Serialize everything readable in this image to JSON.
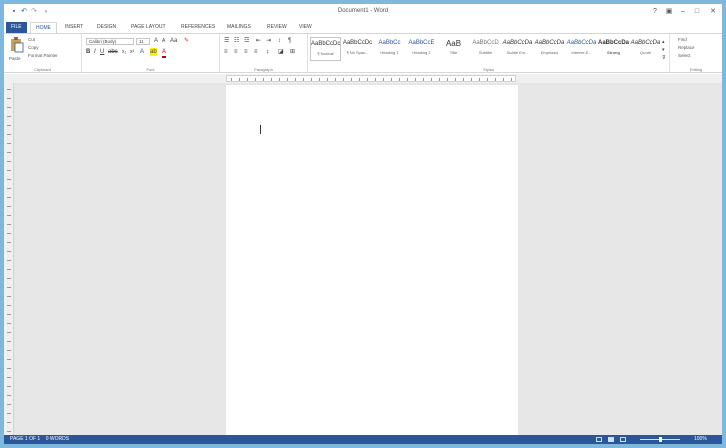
{
  "window": {
    "title": "Document1 - Word",
    "controls": {
      "help": "?",
      "ribbon_options": "▣",
      "minimize": "–",
      "maximize": "□",
      "close": "✕"
    }
  },
  "qat": {
    "save_icon": "save-icon",
    "undo_icon": "undo-icon",
    "redo_icon": "redo-icon"
  },
  "tabs": [
    {
      "label": "FILE"
    },
    {
      "label": "HOME"
    },
    {
      "label": "INSERT"
    },
    {
      "label": "DESIGN"
    },
    {
      "label": "PAGE LAYOUT"
    },
    {
      "label": "REFERENCES"
    },
    {
      "label": "MAILINGS"
    },
    {
      "label": "REVIEW"
    },
    {
      "label": "VIEW"
    }
  ],
  "ribbon": {
    "clipboard": {
      "label": "Clipboard",
      "paste": "Paste",
      "cut": "Cut",
      "copy": "Copy",
      "format_painter": "Format Painter"
    },
    "font": {
      "label": "Font",
      "font_name": "Calibri (Body)",
      "font_size": "11"
    },
    "paragraph": {
      "label": "Paragraph"
    },
    "styles": {
      "label": "Styles",
      "items": [
        {
          "sample": "AaBbCcDc",
          "name": "¶ Normal"
        },
        {
          "sample": "AaBbCcDc",
          "name": "¶ No Spac..."
        },
        {
          "sample": "AaBbCc",
          "name": "Heading 1"
        },
        {
          "sample": "AaBbCcE",
          "name": "Heading 2"
        },
        {
          "sample": "AaB",
          "name": "Title"
        },
        {
          "sample": "AaBbCcD",
          "name": "Subtitle"
        },
        {
          "sample": "AaBbCcDa",
          "name": "Subtle Em..."
        },
        {
          "sample": "AaBbCcDa",
          "name": "Emphasis"
        },
        {
          "sample": "AaBbCcDa",
          "name": "Intense E..."
        },
        {
          "sample": "AaBbCcDa",
          "name": "Strong"
        },
        {
          "sample": "AaBbCcDa",
          "name": "Quote"
        }
      ]
    },
    "editing": {
      "label": "Editing",
      "find": "Find",
      "replace": "Replace",
      "select": "Select"
    }
  },
  "statusbar": {
    "page": "PAGE 1 OF 1",
    "words": "0 WORDS",
    "zoom": "100%"
  },
  "colors": {
    "accent": "#2b579a",
    "canvas": "#e7e7e7"
  }
}
